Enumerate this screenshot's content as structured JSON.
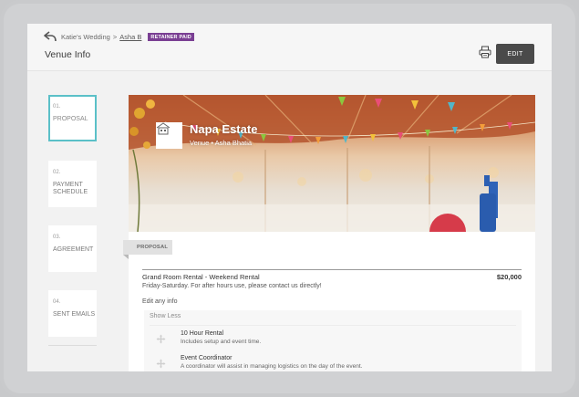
{
  "breadcrumb": {
    "parent": "Katie's Wedding",
    "separator": ">",
    "current": "Asha B",
    "badge": "RETAINER PAID"
  },
  "page": {
    "title": "Venue Info"
  },
  "toolbar": {
    "edit_label": "EDIT"
  },
  "steps": [
    {
      "num": "01.",
      "label": "PROPOSAL",
      "active": true
    },
    {
      "num": "02.",
      "label": "PAYMENT SCHEDULE",
      "active": false
    },
    {
      "num": "03.",
      "label": "AGREEMENT",
      "active": false
    },
    {
      "num": "04.",
      "label": "SENT EMAILS",
      "active": false
    }
  ],
  "hero": {
    "venue_name": "Napa Estate",
    "venue_sub": "Venue • Asha Bhatia"
  },
  "proposal": {
    "tab_label": "PROPOSAL",
    "item_title": "Grand Room Rental - Weekend Rental",
    "item_price": "$20,000",
    "item_desc": "Friday-Saturday. For after hours use, please contact us directly!",
    "edit_info": "Edit any info",
    "show_less": "Show Less",
    "details": [
      {
        "title": "10 Hour Rental",
        "desc": "Includes setup and event time."
      },
      {
        "title": "Event Coordinator",
        "desc": "A coordinator will assist in managing logistics on the day of the event."
      }
    ]
  },
  "colors": {
    "accent": "#5bc0c8",
    "badge": "#7a3f93",
    "edit_button": "#4a4a4a"
  }
}
